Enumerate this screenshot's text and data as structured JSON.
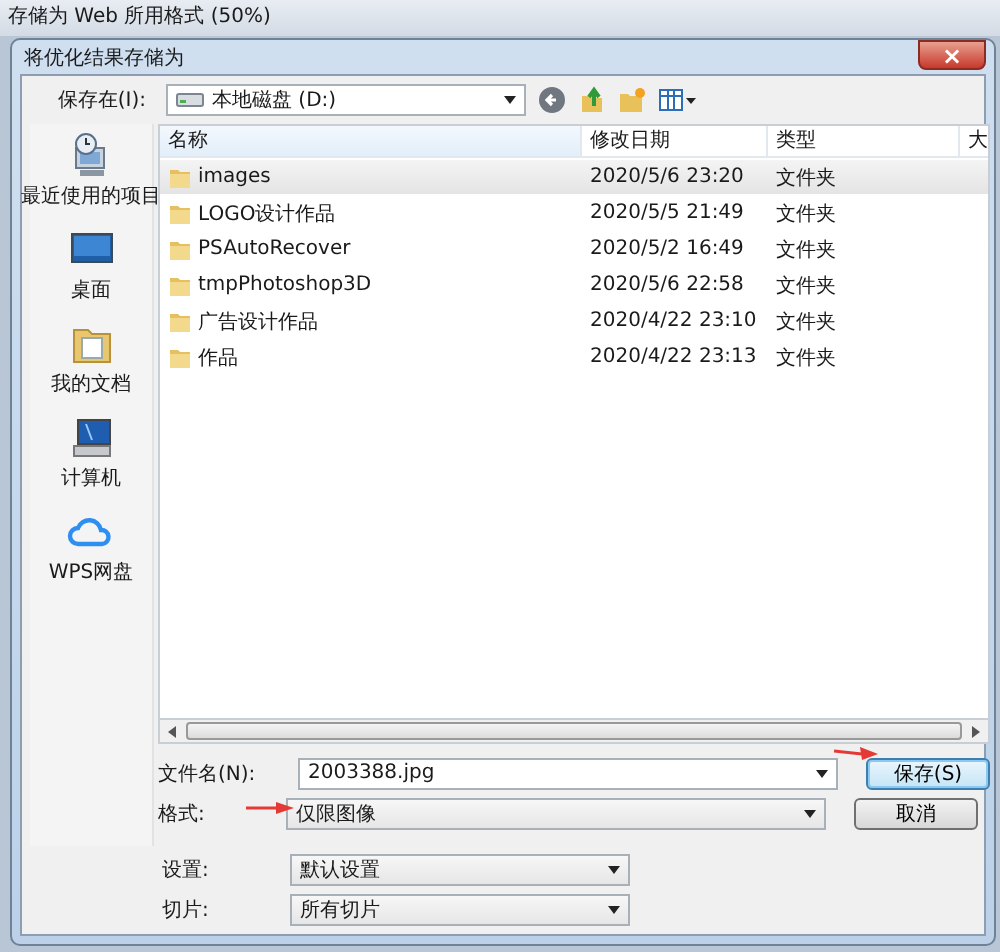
{
  "window": {
    "title": "存储为 Web 所用格式 (50%)"
  },
  "dialog": {
    "title": "将优化结果存储为",
    "close": "×"
  },
  "location": {
    "label": "保存在(I):",
    "value": "本地磁盘  (D:)"
  },
  "sidebar": {
    "items": [
      {
        "label": "最近使用的项目",
        "kind": "recent"
      },
      {
        "label": "桌面",
        "kind": "desktop"
      },
      {
        "label": "我的文档",
        "kind": "documents"
      },
      {
        "label": "计算机",
        "kind": "computer"
      },
      {
        "label": "WPS网盘",
        "kind": "cloud"
      }
    ]
  },
  "table": {
    "columns": [
      "名称",
      "修改日期",
      "类型",
      "大"
    ],
    "rows": [
      {
        "name": "images",
        "date": "2020/5/6 23:20",
        "type": "文件夹",
        "selected": true
      },
      {
        "name": "LOGO设计作品",
        "date": "2020/5/5 21:49",
        "type": "文件夹",
        "selected": false
      },
      {
        "name": "PSAutoRecover",
        "date": "2020/5/2 16:49",
        "type": "文件夹",
        "selected": false
      },
      {
        "name": "tmpPhotoshop3D",
        "date": "2020/5/6 22:58",
        "type": "文件夹",
        "selected": false
      },
      {
        "name": "广告设计作品",
        "date": "2020/4/22 23:10",
        "type": "文件夹",
        "selected": false
      },
      {
        "name": "作品",
        "date": "2020/4/22 23:13",
        "type": "文件夹",
        "selected": false
      }
    ]
  },
  "filename": {
    "label": "文件名(N):",
    "value": "2003388.jpg"
  },
  "format": {
    "label": "格式:",
    "value": "仅限图像"
  },
  "buttons": [
    {
      "label": "保存(S)",
      "kind": "default"
    },
    {
      "label": "取消",
      "kind": "normal"
    }
  ],
  "settings": {
    "label": "设置:",
    "value": "默认设置"
  },
  "slices": {
    "label": "切片:",
    "value": "所有切片"
  }
}
